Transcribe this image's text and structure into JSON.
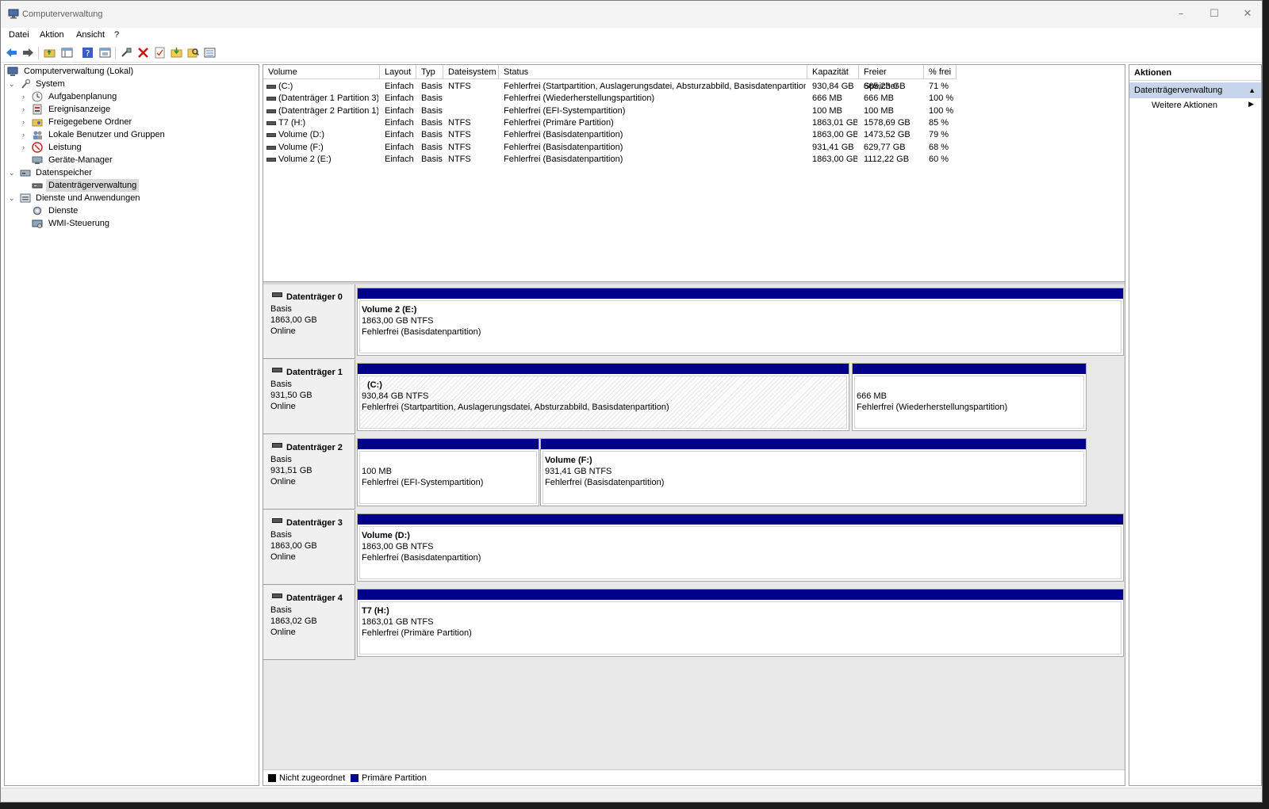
{
  "window": {
    "title": "Computerverwaltung",
    "minimize": "–",
    "maximize": "☐",
    "close": "✕"
  },
  "menu": [
    "Datei",
    "Aktion",
    "Ansicht",
    "?"
  ],
  "tree": {
    "root": "Computerverwaltung (Lokal)",
    "system": "System",
    "system_items": [
      "Aufgabenplanung",
      "Ereignisanzeige",
      "Freigegebene Ordner",
      "Lokale Benutzer und Gruppen",
      "Leistung",
      "Geräte-Manager"
    ],
    "storage": "Datenspeicher",
    "storage_items": [
      "Datenträgerverwaltung"
    ],
    "services": "Dienste und Anwendungen",
    "services_items": [
      "Dienste",
      "WMI-Steuerung"
    ]
  },
  "volume_list": {
    "columns": [
      "Volume",
      "Layout",
      "Typ",
      "Dateisystem",
      "Status",
      "Kapazität",
      "Freier Speicher",
      "% frei"
    ],
    "rows": [
      [
        "(C:)",
        "Einfach",
        "Basis",
        "NTFS",
        "Fehlerfrei (Startpartition, Auslagerungsdatei, Absturzabbild, Basisdatenpartition)",
        "930,84 GB",
        "665,23 GB",
        "71 %"
      ],
      [
        "(Datenträger 1 Partition 3)",
        "Einfach",
        "Basis",
        "",
        "Fehlerfrei (Wiederherstellungspartition)",
        "666 MB",
        "666 MB",
        "100 %"
      ],
      [
        "(Datenträger 2 Partition 1)",
        "Einfach",
        "Basis",
        "",
        "Fehlerfrei (EFI-Systempartition)",
        "100 MB",
        "100 MB",
        "100 %"
      ],
      [
        "T7 (H:)",
        "Einfach",
        "Basis",
        "NTFS",
        "Fehlerfrei (Primäre Partition)",
        "1863,01 GB",
        "1578,69 GB",
        "85 %"
      ],
      [
        "Volume (D:)",
        "Einfach",
        "Basis",
        "NTFS",
        "Fehlerfrei (Basisdatenpartition)",
        "1863,00 GB",
        "1473,52 GB",
        "79 %"
      ],
      [
        "Volume (F:)",
        "Einfach",
        "Basis",
        "NTFS",
        "Fehlerfrei (Basisdatenpartition)",
        "931,41 GB",
        "629,77 GB",
        "68 %"
      ],
      [
        "Volume 2 (E:)",
        "Einfach",
        "Basis",
        "NTFS",
        "Fehlerfrei (Basisdatenpartition)",
        "1863,00 GB",
        "1112,22 GB",
        "60 %"
      ]
    ]
  },
  "disks": [
    {
      "name": "Datenträger 0",
      "type": "Basis",
      "size": "1863,00 GB",
      "state": "Online",
      "partitions": [
        {
          "title": "Volume 2  (E:)",
          "size": "1863,00 GB NTFS",
          "status": "Fehlerfrei (Basisdatenpartition)"
        }
      ]
    },
    {
      "name": "Datenträger 1",
      "type": "Basis",
      "size": "931,50 GB",
      "state": "Online",
      "partitions": [
        {
          "title": "(C:)",
          "size": "930,84 GB NTFS",
          "status": "Fehlerfrei (Startpartition, Auslagerungsdatei, Absturzabbild, Basisdatenpartition)"
        },
        {
          "title": "",
          "size": "666 MB",
          "status": "Fehlerfrei (Wiederherstellungspartition)"
        }
      ]
    },
    {
      "name": "Datenträger 2",
      "type": "Basis",
      "size": "931,51 GB",
      "state": "Online",
      "partitions": [
        {
          "title": "",
          "size": "100 MB",
          "status": "Fehlerfrei (EFI-Systempartition)"
        },
        {
          "title": "Volume  (F:)",
          "size": "931,41 GB NTFS",
          "status": "Fehlerfrei (Basisdatenpartition)"
        }
      ]
    },
    {
      "name": "Datenträger 3",
      "type": "Basis",
      "size": "1863,00 GB",
      "state": "Online",
      "partitions": [
        {
          "title": "Volume  (D:)",
          "size": "1863,00 GB NTFS",
          "status": "Fehlerfrei (Basisdatenpartition)"
        }
      ]
    },
    {
      "name": "Datenträger 4",
      "type": "Basis",
      "size": "1863,02 GB",
      "state": "Online",
      "partitions": [
        {
          "title": "T7  (H:)",
          "size": "1863,01 GB NTFS",
          "status": "Fehlerfrei (Primäre Partition)"
        }
      ]
    }
  ],
  "legend": {
    "unallocated": "Nicht zugeordnet",
    "primary": "Primäre Partition",
    "unallocated_color": "#000000",
    "primary_color": "#00008b"
  },
  "actions": {
    "header": "Aktionen",
    "section": "Datenträgerverwaltung",
    "more": "Weitere Aktionen"
  },
  "icons": [
    "back-arrow-icon",
    "forward-arrow-icon",
    "up-folder-icon",
    "show-tree-icon",
    "help-icon",
    "properties-icon",
    "connect-icon",
    "delete-icon",
    "check-icon",
    "folder-icon",
    "search-icon",
    "list-view-icon"
  ]
}
